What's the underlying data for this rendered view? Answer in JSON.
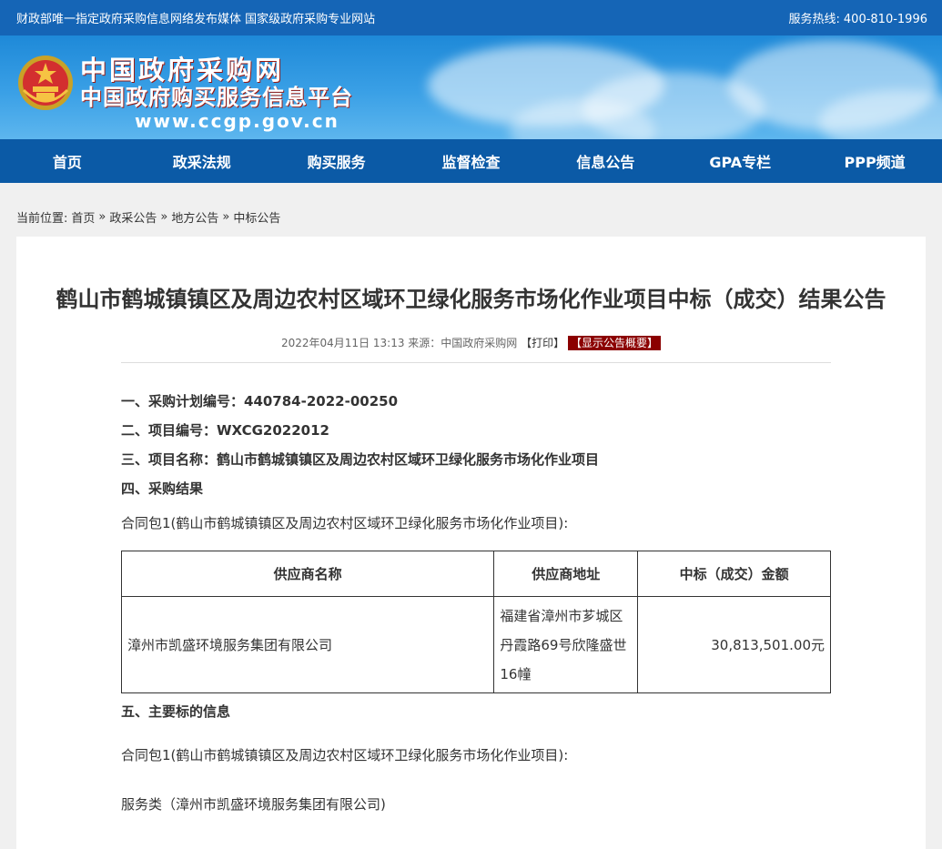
{
  "topbar": {
    "slogan": "财政部唯一指定政府采购信息网络发布媒体 国家级政府采购专业网站",
    "hotline_label": "服务热线:",
    "hotline_number": "400-810-1996"
  },
  "brand": {
    "line1": "中国政府采购网",
    "line2": "中国政府购买服务信息平台",
    "url": "www.ccgp.gov.cn"
  },
  "nav": [
    {
      "label": "首页"
    },
    {
      "label": "政采法规"
    },
    {
      "label": "购买服务"
    },
    {
      "label": "监督检查"
    },
    {
      "label": "信息公告"
    },
    {
      "label": "GPA专栏"
    },
    {
      "label": "PPP频道"
    }
  ],
  "breadcrumb": {
    "prefix": "当前位置:",
    "items": [
      "首页",
      "政采公告",
      "地方公告",
      "中标公告"
    ],
    "sep": "»"
  },
  "article": {
    "title": "鹤山市鹤城镇镇区及周边农村区域环卫绿化服务市场化作业项目中标（成交）结果公告",
    "date": "2022年04月11日 13:13",
    "source": "来源：中国政府采购网",
    "print": "【打印】",
    "overview": "【显示公告概要】",
    "sections": {
      "s1": "一、采购计划编号：440784-2022-00250",
      "s2": "二、项目编号：WXCG2022012",
      "s3": "三、项目名称：鹤山市鹤城镇镇区及周边农村区域环卫绿化服务市场化作业项目",
      "s4": "四、采购结果",
      "s5": "五、主要标的信息"
    },
    "package_label": "合同包1(鹤山市鹤城镇镇区及周边农村区域环卫绿化服务市场化作业项目):",
    "service_line": "服务类（漳州市凯盛环境服务集团有限公司)",
    "table": {
      "headers": [
        "供应商名称",
        "供应商地址",
        "中标（成交）金额"
      ],
      "rows": [
        [
          "漳州市凯盛环境服务集团有限公司",
          "福建省漳州市芗城区丹霞路69号欣隆盛世16幢",
          "30,813,501.00元"
        ]
      ]
    }
  },
  "colors": {
    "topbar": "#1565b6",
    "nav": "#0b5aa6",
    "overview_badge": "#8b0000"
  }
}
